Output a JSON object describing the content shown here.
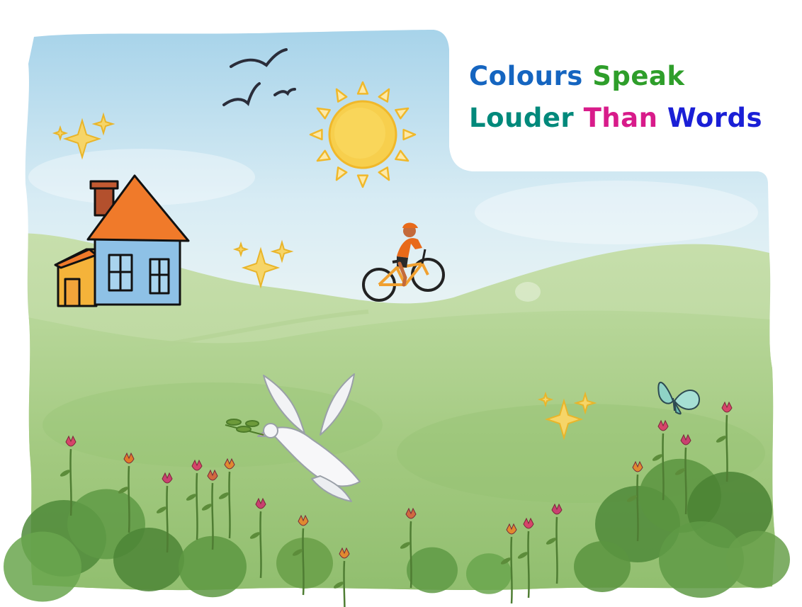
{
  "title": {
    "line1": [
      {
        "text": "Colours",
        "color": "#1565c0"
      },
      {
        "text": "Speak",
        "color": "#2e9e2a"
      }
    ],
    "line2": [
      {
        "text": "Louder",
        "color": "#00897b"
      },
      {
        "text": "Than",
        "color": "#d81b8a"
      },
      {
        "text": "Words",
        "color": "#1a1fd6"
      }
    ]
  },
  "scene": {
    "sky_color": "#a9d3ea",
    "grass_color": "#9fc77a",
    "sun_color": "#f5c63b",
    "roof_color": "#f07a2a",
    "wall_color": "#8ec1e6",
    "annex_color": "#f5b33a",
    "icons": [
      "bird-icon",
      "sun-icon",
      "sparkle-icon",
      "house-icon",
      "cyclist-icon",
      "dove-icon",
      "butterfly-icon",
      "flower-icon",
      "bush-icon"
    ]
  }
}
